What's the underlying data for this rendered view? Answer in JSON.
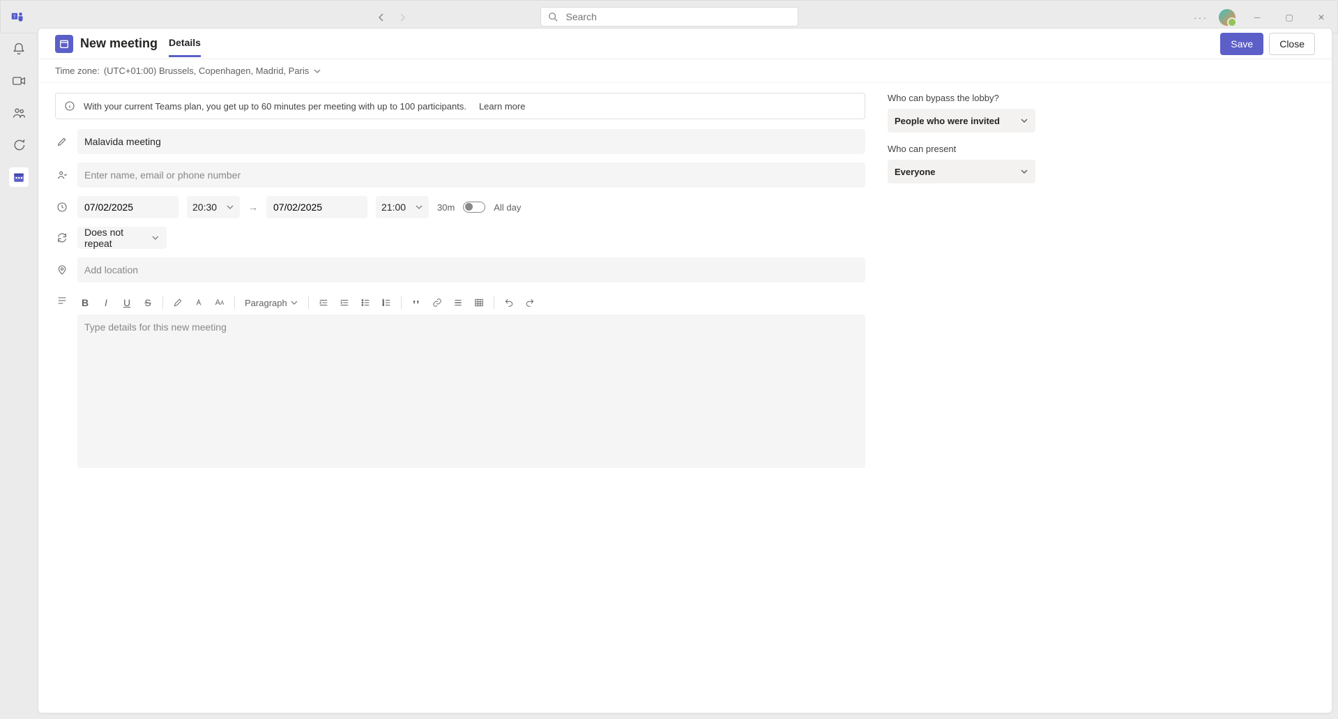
{
  "topbar": {
    "search_placeholder": "Search"
  },
  "header": {
    "title": "New meeting",
    "tab_details": "Details",
    "save": "Save",
    "close": "Close"
  },
  "tz": {
    "label": "Time zone:",
    "value": "(UTC+01:00) Brussels, Copenhagen, Madrid, Paris"
  },
  "info": {
    "text": "With your current Teams plan, you get up to 60 minutes per meeting with up to 100 participants.",
    "learn": "Learn more"
  },
  "form": {
    "title_value": "Malavida meeting",
    "attendees_placeholder": "Enter name, email or phone number",
    "start_date": "07/02/2025",
    "start_time": "20:30",
    "end_date": "07/02/2025",
    "end_time": "21:00",
    "duration": "30m",
    "all_day": "All day",
    "repeat": "Does not repeat",
    "location_placeholder": "Add location",
    "paragraph": "Paragraph",
    "details_placeholder": "Type details for this new meeting"
  },
  "side": {
    "bypass_label": "Who can bypass the lobby?",
    "bypass_value": "People who were invited",
    "present_label": "Who can present",
    "present_value": "Everyone"
  }
}
